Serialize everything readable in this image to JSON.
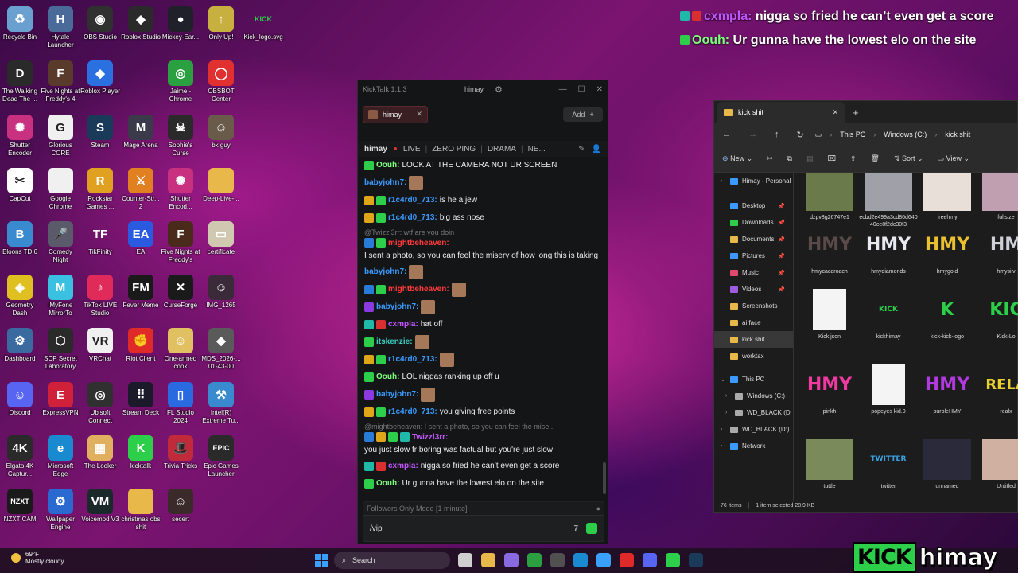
{
  "desktop": {
    "icons": [
      {
        "label": "Recycle Bin",
        "icon": "recycle-bin-icon",
        "color": "#6aa0d0",
        "glyph": "♻"
      },
      {
        "label": "Hytale Launcher",
        "icon": "hytale-icon",
        "color": "#4a6a9a",
        "glyph": "H"
      },
      {
        "label": "OBS Studio",
        "icon": "obs-icon",
        "color": "#303030",
        "glyph": "◉"
      },
      {
        "label": "Roblox Studio",
        "icon": "roblox-studio-icon",
        "color": "#2a2a2a",
        "glyph": "◆"
      },
      {
        "label": "Mickey-Ear...",
        "icon": "mickey-icon",
        "color": "#20202a",
        "glyph": "●"
      },
      {
        "label": "Only Up!",
        "icon": "only-up-icon",
        "color": "#c8b040",
        "glyph": "↑"
      },
      {
        "label": "Kick_logo.svg",
        "icon": "kick-logo-icon",
        "color": "transparent",
        "glyph": "KICK"
      },
      {
        "label": "The Walking Dead The ...",
        "icon": "walking-dead-icon",
        "color": "#2a2a2a",
        "glyph": "D"
      },
      {
        "label": "Five Nights at Freddy's 4",
        "icon": "fnaf4-icon",
        "color": "#5a3a2a",
        "glyph": "F"
      },
      {
        "label": "Roblox Player",
        "icon": "roblox-player-icon",
        "color": "#2a70e0",
        "glyph": "◆"
      },
      {
        "label": "Jaime - Chrome",
        "icon": "chrome-icon",
        "color": "#2aa040",
        "glyph": "◎"
      },
      {
        "label": "OBSBOT Center",
        "icon": "obsbot-icon",
        "color": "#e03030",
        "glyph": "◯"
      },
      {
        "label": "Shutter Encoder",
        "icon": "shutter-encoder-icon",
        "color": "#c83080",
        "glyph": "✺"
      },
      {
        "label": "Glorious CORE",
        "icon": "glorious-icon",
        "color": "#f0f0f0",
        "glyph": "G"
      },
      {
        "label": "Steam",
        "icon": "steam-icon",
        "color": "#1a3a5a",
        "glyph": "S"
      },
      {
        "label": "Mage Arena",
        "icon": "mage-arena-icon",
        "color": "#3a3a4a",
        "glyph": "M"
      },
      {
        "label": "Sophie's Curse",
        "icon": "sophies-curse-icon",
        "color": "#2a2a2a",
        "glyph": "☠"
      },
      {
        "label": "bk guy",
        "icon": "bk-guy-icon",
        "color": "#6a5a4a",
        "glyph": "☺"
      },
      {
        "label": "CapCut",
        "icon": "capcut-icon",
        "color": "#ffffff",
        "glyph": "✂"
      },
      {
        "label": "Google Chrome",
        "icon": "file-icon",
        "color": "#f0f0f0",
        "glyph": " "
      },
      {
        "label": "Rockstar Games ...",
        "icon": "rockstar-icon",
        "color": "#e0a020",
        "glyph": "R"
      },
      {
        "label": "Counter-Str... 2",
        "icon": "cs2-icon",
        "color": "#e08020",
        "glyph": "⚔"
      },
      {
        "label": "Shutter Encod...",
        "icon": "shutter-encoder-icon",
        "color": "#c83080",
        "glyph": "✺"
      },
      {
        "label": "Deep-Live-...",
        "icon": "folder-icon",
        "color": "#e8b84a",
        "glyph": " "
      },
      {
        "label": "Bloons TD 6",
        "icon": "bloons-icon",
        "color": "#3a8ad0",
        "glyph": "B"
      },
      {
        "label": "Comedy Night",
        "icon": "comedy-night-icon",
        "color": "#5a5a6a",
        "glyph": "🎤"
      },
      {
        "label": "TikFinity",
        "icon": "tikfinity-icon",
        "color": "transparent",
        "glyph": "TF"
      },
      {
        "label": "EA",
        "icon": "ea-icon",
        "color": "#2a5ae0",
        "glyph": "EA"
      },
      {
        "label": "Five Nights at Freddy's",
        "icon": "fnaf-icon",
        "color": "#4a2a1a",
        "glyph": "F"
      },
      {
        "label": "certificate",
        "icon": "certificate-icon",
        "color": "#d0c8b0",
        "glyph": "▭"
      },
      {
        "label": "Geometry Dash",
        "icon": "geometry-dash-icon",
        "color": "#e0c020",
        "glyph": "◈"
      },
      {
        "label": "iMyFone MirrorTo",
        "icon": "imyfone-icon",
        "color": "#3ac0e0",
        "glyph": "M"
      },
      {
        "label": "TikTok LIVE Studio",
        "icon": "tiktok-icon",
        "color": "#e02a5a",
        "glyph": "♪"
      },
      {
        "label": "Fever Meme",
        "icon": "fever-meme-icon",
        "color": "#1a1a1a",
        "glyph": "FM"
      },
      {
        "label": "CurseForge",
        "icon": "curseforge-icon",
        "color": "#1a1a1a",
        "glyph": "✕"
      },
      {
        "label": "IMG_1265",
        "icon": "image-file-icon",
        "color": "#3a2a3a",
        "glyph": "☺"
      },
      {
        "label": "Dashboard",
        "icon": "dashboard-icon",
        "color": "#3a6aa0",
        "glyph": "⚙"
      },
      {
        "label": "SCP Secret Laboratory",
        "icon": "scp-icon",
        "color": "#2a2a2a",
        "glyph": "⬡"
      },
      {
        "label": "VRChat",
        "icon": "vrchat-icon",
        "color": "#f0f0f0",
        "glyph": "VR"
      },
      {
        "label": "Riot Client",
        "icon": "riot-icon",
        "color": "#e02a2a",
        "glyph": "✊"
      },
      {
        "label": "One-armed cook",
        "icon": "one-armed-cook-icon",
        "color": "#e0c060",
        "glyph": "☺"
      },
      {
        "label": "MDS_2026-... 01-43-00",
        "icon": "file-icon",
        "color": "#5a5a5a",
        "glyph": "◆"
      },
      {
        "label": "Discord",
        "icon": "discord-icon",
        "color": "#5865f2",
        "glyph": "☺"
      },
      {
        "label": "ExpressVPN",
        "icon": "expressvpn-icon",
        "color": "#d0203a",
        "glyph": "E"
      },
      {
        "label": "Ubisoft Connect",
        "icon": "ubisoft-icon",
        "color": "#303030",
        "glyph": "◎"
      },
      {
        "label": "Stream Deck",
        "icon": "stream-deck-icon",
        "color": "#1a1a2a",
        "glyph": "⠿"
      },
      {
        "label": "FL Studio 2024",
        "icon": "fl-studio-icon",
        "color": "#2a6ae0",
        "glyph": "▯"
      },
      {
        "label": "Intel(R) Extreme Tu...",
        "icon": "intel-icon",
        "color": "#3a8ad0",
        "glyph": "⚒"
      },
      {
        "label": "Elgato 4K Captur...",
        "icon": "elgato-icon",
        "color": "#2a2a2a",
        "glyph": "4K"
      },
      {
        "label": "Microsoft Edge",
        "icon": "edge-icon",
        "color": "#1a8ad0",
        "glyph": "e"
      },
      {
        "label": "The Looker",
        "icon": "the-looker-icon",
        "color": "#e0b060",
        "glyph": "▦"
      },
      {
        "label": "kicktalk",
        "icon": "kicktalk-icon",
        "color": "#2dcf4a",
        "glyph": "K"
      },
      {
        "label": "Trivia Tricks",
        "icon": "trivia-tricks-icon",
        "color": "#c02a3a",
        "glyph": "🎩"
      },
      {
        "label": "Epic Games Launcher",
        "icon": "epic-games-icon",
        "color": "#2a2a2a",
        "glyph": "EPIC"
      },
      {
        "label": "NZXT CAM",
        "icon": "nzxt-icon",
        "color": "#1a1a1a",
        "glyph": "NZXT"
      },
      {
        "label": "Wallpaper Engine",
        "icon": "wallpaper-engine-icon",
        "color": "#2a6ad0",
        "glyph": "⚙"
      },
      {
        "label": "Voicemod V3",
        "icon": "voicemod-icon",
        "color": "#1a2a2a",
        "glyph": "VM"
      },
      {
        "label": "christmas obs shit",
        "icon": "folder-icon",
        "color": "#e8b84a",
        "glyph": " "
      },
      {
        "label": "secert",
        "icon": "image-file-icon",
        "color": "#3a2a2a",
        "glyph": "☺"
      }
    ]
  },
  "overlay": {
    "lines": [
      {
        "user": "cxmpla:",
        "text": "nigga so fried he can’t even get a score",
        "user_color": "#c056ff"
      },
      {
        "user": "Oouh:",
        "text": "Ur gunna have the lowest elo on the site",
        "user_color": "#7cff7c"
      }
    ]
  },
  "kicktalk": {
    "title": "KickTalk 1.1.3",
    "user": "himay",
    "tab_label": "himay",
    "add_label": "Add",
    "channel": "himay",
    "tags": [
      "LIVE",
      "ZERO PING",
      "DRAMA",
      "NE..."
    ],
    "messages": [
      {
        "badges": [
          "green"
        ],
        "user": "Oouh:",
        "color": "#7cff7c",
        "text": "LOOK AT THE CAMERA NOT UR SCREEN",
        "emote": false
      },
      {
        "badges": [],
        "user": "babyjohn7:",
        "color": "#3a9aff",
        "text": "",
        "emote": true
      },
      {
        "badges": [
          "gold",
          "green"
        ],
        "user": "r1c4rd0_713:",
        "color": "#3a9aff",
        "text": "is he a jew",
        "emote": false
      },
      {
        "badges": [
          "gold",
          "green"
        ],
        "user": "r1c4rd0_713:",
        "color": "#3a9aff",
        "text": "big ass nose",
        "emote": false
      },
      {
        "reply": "@Twizzl3rr: wtf are you doin"
      },
      {
        "badges": [
          "blue",
          "green"
        ],
        "user": "mightbeheaven:",
        "color": "#ff3a3a",
        "text": "I sent a photo, so you can feel the misery of how long this is taking",
        "emote": false,
        "wrap": true
      },
      {
        "badges": [],
        "user": "babyjohn7:",
        "color": "#3a9aff",
        "text": "",
        "emote": true
      },
      {
        "badges": [
          "blue",
          "green"
        ],
        "user": "mightbeheaven:",
        "color": "#ff3a3a",
        "text": "",
        "emote": true
      },
      {
        "badges": [
          "purple"
        ],
        "user": "babyjohn7:",
        "color": "#3a9aff",
        "text": "",
        "emote": true
      },
      {
        "badges": [
          "teal",
          "red"
        ],
        "user": "cxmpla:",
        "color": "#c056ff",
        "text": "hat off",
        "emote": false
      },
      {
        "badges": [
          "green"
        ],
        "user": "itskenzie:",
        "color": "#3ad0c0",
        "text": "",
        "emote": true
      },
      {
        "badges": [
          "gold",
          "green"
        ],
        "user": "r1c4rd0_713:",
        "color": "#3a9aff",
        "text": "",
        "emote": true
      },
      {
        "badges": [
          "green"
        ],
        "user": "Oouh:",
        "color": "#7cff7c",
        "text": "LOL niggas ranking up off u",
        "emote": false
      },
      {
        "badges": [
          "purple"
        ],
        "user": "babyjohn7:",
        "color": "#3a9aff",
        "text": "",
        "emote": true
      },
      {
        "badges": [
          "gold",
          "green"
        ],
        "user": "r1c4rd0_713:",
        "color": "#3a9aff",
        "text": "you giving free points",
        "emote": false
      },
      {
        "reply": "@mightbeheaven: I sent a photo, so you can feel the mise..."
      },
      {
        "badges": [
          "blue",
          "gold",
          "green",
          "teal"
        ],
        "user": "Twizzl3rr:",
        "color": "#c056ff",
        "text": "you just slow fr boring was factual but you're just slow",
        "emote": false,
        "wrap": true
      },
      {
        "badges": [
          "teal",
          "red"
        ],
        "user": "cxmpla:",
        "color": "#c056ff",
        "text": "nigga so fried he can’t even get a score",
        "emote": false
      },
      {
        "badges": [
          "green"
        ],
        "user": "Oouh:",
        "color": "#7cff7c",
        "text": "Ur gunna have the lowest elo on the site",
        "emote": false
      }
    ],
    "mode_label": "Followers Only Mode [1 minute]",
    "input_value": "/vip"
  },
  "explorer": {
    "tab_title": "kick shit",
    "path": [
      "This PC",
      "Windows (C:)",
      "kick shit"
    ],
    "toolbar": {
      "new": "New",
      "sort": "Sort",
      "view": "View"
    },
    "sidebar": [
      {
        "label": "Himay - Personal",
        "kind": "cloud",
        "caret": "›"
      },
      {
        "label": "Desktop",
        "kind": "folder-blue",
        "pin": true
      },
      {
        "label": "Downloads",
        "kind": "folder-green",
        "pin": true
      },
      {
        "label": "Documents",
        "kind": "folder",
        "pin": true
      },
      {
        "label": "Pictures",
        "kind": "folder-blue",
        "pin": true
      },
      {
        "label": "Music",
        "kind": "folder-red",
        "pin": true
      },
      {
        "label": "Videos",
        "kind": "folder-purple",
        "pin": true
      },
      {
        "label": "Screenshots",
        "kind": "folder"
      },
      {
        "label": "ai face",
        "kind": "folder"
      },
      {
        "label": "kick shit",
        "kind": "folder",
        "selected": true
      },
      {
        "label": "worktax",
        "kind": "folder"
      },
      {
        "label": "This PC",
        "kind": "pc",
        "caret": "⌄"
      },
      {
        "label": "Windows (C:)",
        "kind": "drive",
        "caret": "›",
        "sub": true
      },
      {
        "label": "WD_BLACK (D",
        "kind": "drive",
        "caret": "›",
        "sub": true
      },
      {
        "label": "WD_BLACK (D:)",
        "kind": "drive",
        "caret": "›"
      },
      {
        "label": "Network",
        "kind": "network",
        "caret": "›"
      }
    ],
    "files": [
      {
        "name": "dzpv8g26747e1",
        "thumb": "#6a7a4a",
        "glyph": ""
      },
      {
        "name": "ecbd2e499a3cd86d64040ce8f2dc30f3",
        "thumb": "#a0a0a8",
        "glyph": ""
      },
      {
        "name": "freehmy",
        "thumb": "#e8e0d8",
        "glyph": ""
      },
      {
        "name": "fullsize",
        "thumb": "#c0a0b0",
        "glyph": ""
      },
      {
        "name": "hmycacaroach",
        "thumb": "transparent",
        "glyph": "HMY",
        "gcolor": "#5a4a4a"
      },
      {
        "name": "hmydiamonds",
        "thumb": "transparent",
        "glyph": "HMY",
        "gcolor": "#e8e8f0"
      },
      {
        "name": "hmygold",
        "thumb": "transparent",
        "glyph": "HMY",
        "gcolor": "#e8c030"
      },
      {
        "name": "hmysilv",
        "thumb": "transparent",
        "glyph": "HM",
        "gcolor": "#d0d0d8"
      },
      {
        "name": "Kick.json",
        "thumb": "#f4f4f4",
        "glyph": ""
      },
      {
        "name": "kickhimay",
        "thumb": "transparent",
        "glyph": "KICK",
        "gcolor": "#2dcf4a",
        "small": true
      },
      {
        "name": "kick-kick-logo",
        "thumb": "transparent",
        "glyph": "K",
        "gcolor": "#2dcf4a"
      },
      {
        "name": "Kick-Lo",
        "thumb": "transparent",
        "glyph": "KIC",
        "gcolor": "#2dcf4a"
      },
      {
        "name": "pinkh",
        "thumb": "transparent",
        "glyph": "HMY",
        "gcolor": "#f03aa0"
      },
      {
        "name": "popeyes kid.0",
        "thumb": "#f4f4f4",
        "glyph": ""
      },
      {
        "name": "purpleHMY",
        "thumb": "transparent",
        "glyph": "HMY",
        "gcolor": "#b03ae0"
      },
      {
        "name": "realx",
        "thumb": "transparent",
        "glyph": "RELA",
        "gcolor": "#e8d030"
      },
      {
        "name": "tuttle",
        "thumb": "#7a8a5a",
        "glyph": ""
      },
      {
        "name": "twitter",
        "thumb": "transparent",
        "glyph": "TWITTER",
        "gcolor": "#3aa0e0",
        "small": true
      },
      {
        "name": "unnamed",
        "thumb": "#2a2a3a",
        "glyph": ""
      },
      {
        "name": "Untitled",
        "thumb": "#d0b0a0",
        "glyph": ""
      }
    ],
    "status": {
      "count": "76 items",
      "selection": "1 item selected  28.9 KB"
    }
  },
  "taskbar": {
    "temp": "69°F",
    "weather": "Mostly cloudy",
    "search_placeholder": "Search",
    "pinned": [
      {
        "icon": "task-view-icon",
        "color": "#cfcfcf"
      },
      {
        "icon": "file-explorer-icon",
        "color": "#e8b84a"
      },
      {
        "icon": "copilot-icon",
        "color": "#8a6ae0"
      },
      {
        "icon": "chrome-icon",
        "color": "#2aa040"
      },
      {
        "icon": "obs-icon",
        "color": "#505050"
      },
      {
        "icon": "edge-icon",
        "color": "#1a8ad0"
      },
      {
        "icon": "store-icon",
        "color": "#3aa0ff"
      },
      {
        "icon": "youtube-icon",
        "color": "#e02a2a"
      },
      {
        "icon": "discord-icon",
        "color": "#5865f2"
      },
      {
        "icon": "kick-icon",
        "color": "#2dcf4a"
      },
      {
        "icon": "steam-icon",
        "color": "#1a3a5a"
      }
    ]
  },
  "branding": {
    "kick": "KICK",
    "name": "himay"
  }
}
